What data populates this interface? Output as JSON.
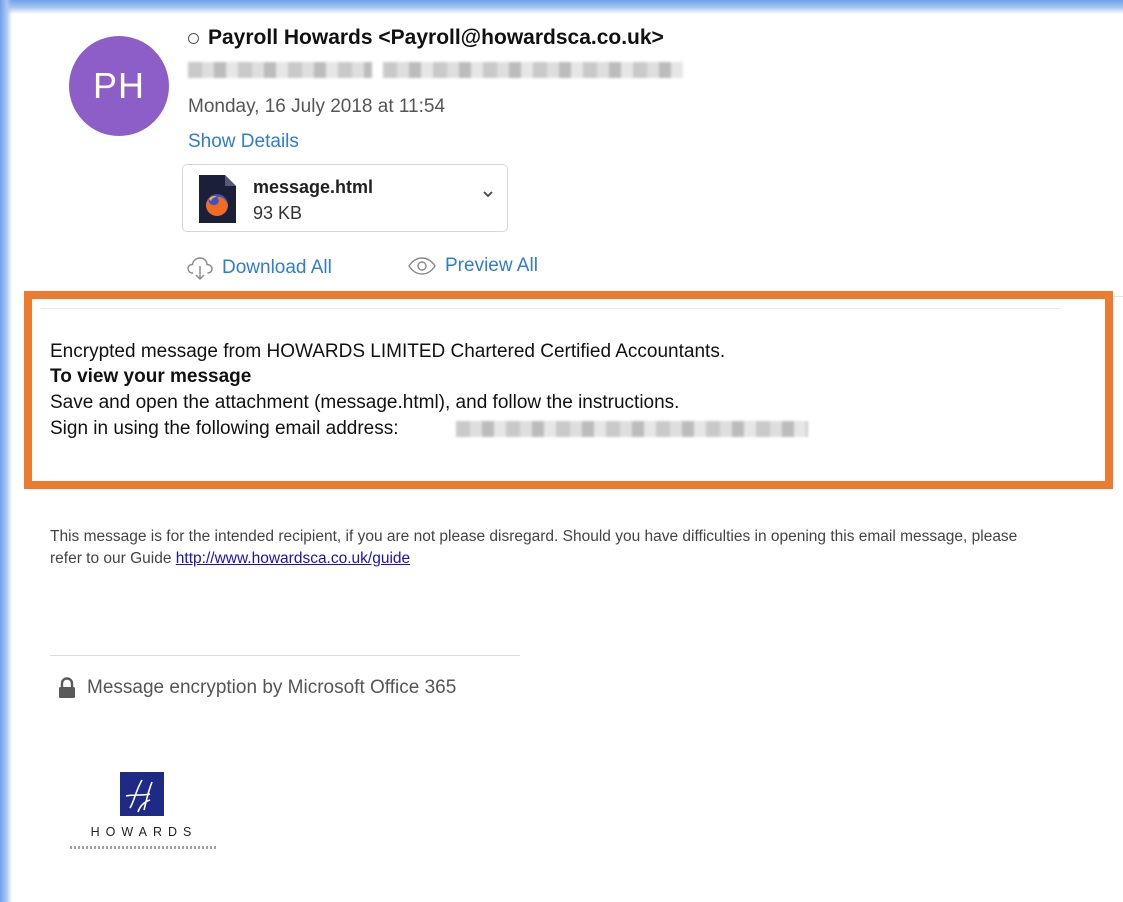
{
  "sender": {
    "initials": "PH",
    "display": "Payroll Howards <Payroll@howardsca.co.uk>",
    "date": "Monday, 16 July 2018 at 11:54",
    "show_details": "Show Details"
  },
  "attachment": {
    "name": "message.html",
    "size": "93 KB",
    "icon": "firefox-html-file-icon"
  },
  "actions": {
    "download_all": "Download All",
    "preview_all": "Preview All"
  },
  "message": {
    "line1": "Encrypted message from HOWARDS LIMITED Chartered Certified Accountants.",
    "line2": "To view your message",
    "line3": "Save and open the attachment (message.html), and follow the instructions.",
    "line4": "Sign in using the following email address:"
  },
  "disclaimer": {
    "text": "This message is for the intended recipient, if you are not please disregard. Should you have difficulties in opening this email message, please refer to our Guide ",
    "link": "http://www.howardsca.co.uk/guide"
  },
  "footer": {
    "encryption": "Message encryption by Microsoft Office 365",
    "logo_text": "HOWARDS"
  },
  "colors": {
    "avatar": "#8d5ec8",
    "link": "#2f7bd6",
    "highlight": "#ee7a2f"
  }
}
